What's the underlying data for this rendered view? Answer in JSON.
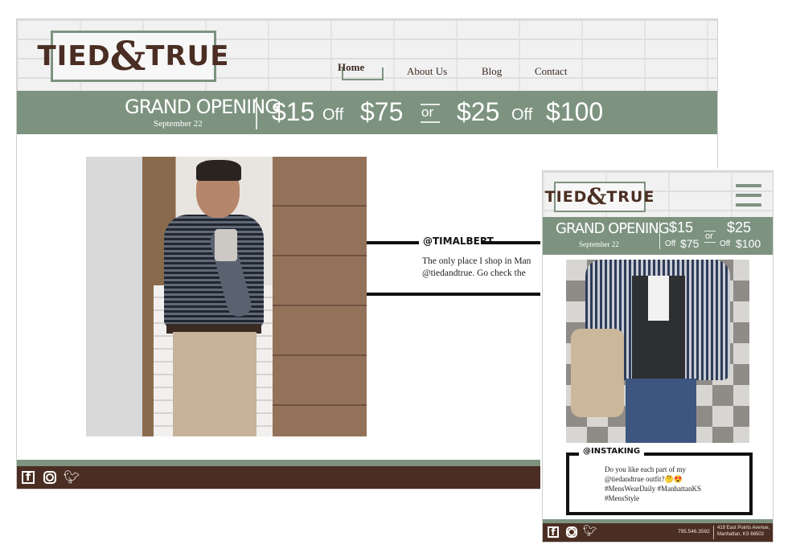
{
  "brand": {
    "logo_left": "TIED",
    "logo_amp": "&",
    "logo_right": "TRUE"
  },
  "desktop": {
    "nav": {
      "home": "Home",
      "about": "About Us",
      "blog": "Blog",
      "contact": "Contact"
    },
    "promo": {
      "title": "GRAND OPENING",
      "date": "September 22",
      "offer1_amount": "$15",
      "offer1_off": "Off",
      "offer1_min": "$75",
      "or": "or",
      "offer2_amount": "$25",
      "offer2_off": "Off",
      "offer2_min": "$100"
    },
    "post": {
      "handle": "@TIMALBERT",
      "quote_line1": "The only place I shop in Man",
      "quote_line2": "@tiedandtrue. Go check the"
    },
    "footer_icons": [
      "facebook-icon",
      "instagram-icon",
      "twitter-icon"
    ]
  },
  "mobile": {
    "promo": {
      "title": "GRAND OPENING",
      "date": "September 22",
      "offer1_amount": "$15",
      "offer1_off": "Off",
      "offer1_min": "$75",
      "or": "or",
      "offer2_amount": "$25",
      "offer2_off": "Off",
      "offer2_min": "$100"
    },
    "post": {
      "handle": "@INSTAKING",
      "line1": "Do you like each part of my",
      "line2": "@tiedandtrue outfit?🤔😍",
      "line3": "#MensWearDaily #ManhattanKS",
      "line4": "#MensStyle"
    },
    "footer": {
      "phone": "795.546.3592",
      "address_line1": "419 East Points Avenue,",
      "address_line2": "Manhattan, KS 66502"
    }
  },
  "colors": {
    "sage": "#7d9380",
    "brown": "#4b2e23",
    "white": "#ffffff"
  }
}
